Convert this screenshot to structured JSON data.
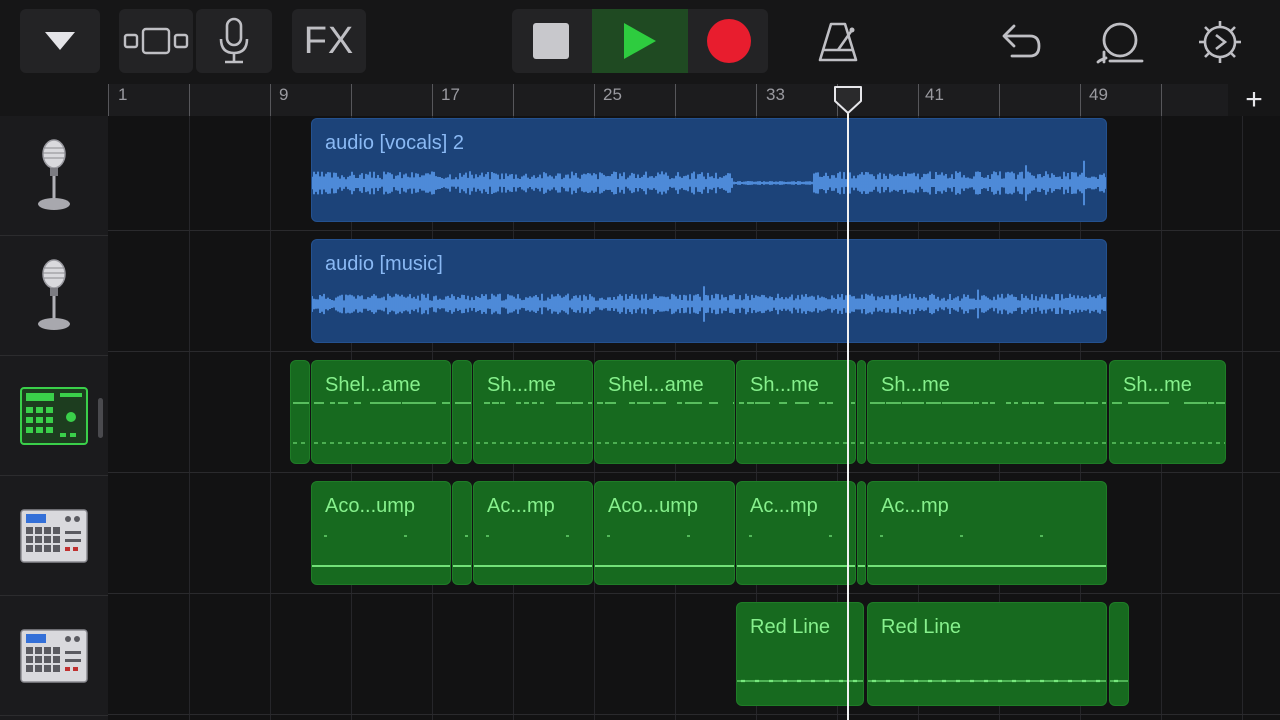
{
  "toolbar": {
    "fx_label": "FX",
    "icons": [
      "tracks-menu-icon",
      "view-switch-icon",
      "microphone-icon",
      "fx-button",
      "stop-icon",
      "play-icon",
      "record-icon",
      "metronome-icon",
      "undo-icon",
      "loop-browser-icon",
      "settings-icon"
    ],
    "colors": {
      "play": "#2ecc3f",
      "record": "#e81d2e",
      "stop": "#c8c8cc"
    }
  },
  "ruler": {
    "labels": [
      "1",
      "9",
      "17",
      "25",
      "33",
      "41",
      "49"
    ],
    "add_label": "+"
  },
  "tracks": [
    {
      "icon": "microphone-instrument-icon",
      "regions": [
        {
          "title": "audio [vocals] 2",
          "type": "audio"
        }
      ]
    },
    {
      "icon": "microphone-instrument-icon",
      "regions": [
        {
          "title": "audio [music]",
          "type": "audio"
        }
      ]
    },
    {
      "icon": "beat-sequencer-icon",
      "regions": [
        {
          "title": "Shel...ame"
        },
        {
          "title": "Sh...me"
        },
        {
          "title": "Shel...ame"
        },
        {
          "title": "Sh...me"
        },
        {
          "title": "Sh...me"
        },
        {
          "title": "Sh...me"
        }
      ]
    },
    {
      "icon": "drum-machine-icon",
      "regions": [
        {
          "title": "Aco...ump"
        },
        {
          "title": "Ac...mp"
        },
        {
          "title": "Aco...ump"
        },
        {
          "title": "Ac...mp"
        },
        {
          "title": "Ac...mp"
        }
      ]
    },
    {
      "icon": "drum-machine-icon",
      "regions": [
        {
          "title": "Red Line"
        },
        {
          "title": "Red Line"
        }
      ]
    }
  ],
  "colors": {
    "audio_region": "#1c4379",
    "midi_region": "#176a1f",
    "audio_wave": "#5a9cf0",
    "midi_notes": "#7cee82"
  }
}
